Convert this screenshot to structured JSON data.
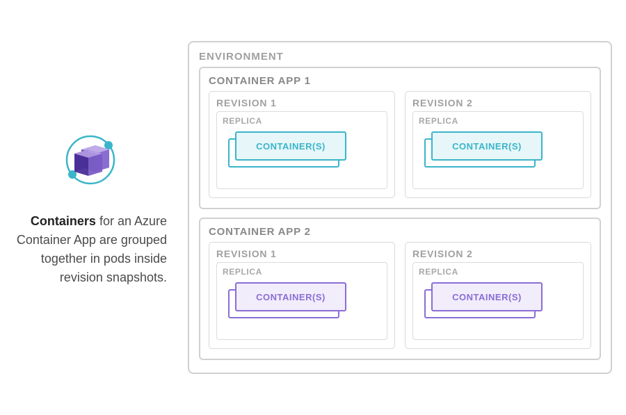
{
  "description": {
    "bold": "Containers",
    "rest": " for an Azure Container App are grouped together in pods inside revision snapshots."
  },
  "environment": {
    "label": "ENVIRONMENT",
    "apps": [
      {
        "label": "CONTAINER APP 1",
        "color": "teal",
        "revisions": [
          {
            "label": "REVISION 1",
            "replica": "REPLICA",
            "container": "CONTAINER(S)"
          },
          {
            "label": "REVISION 2",
            "replica": "REPLICA",
            "container": "CONTAINER(S)"
          }
        ]
      },
      {
        "label": "CONTAINER APP 2",
        "color": "purple",
        "revisions": [
          {
            "label": "REVISION 1",
            "replica": "REPLICA",
            "container": "CONTAINER(S)"
          },
          {
            "label": "REVISION 2",
            "replica": "REPLICA",
            "container": "CONTAINER(S)"
          }
        ]
      }
    ]
  }
}
